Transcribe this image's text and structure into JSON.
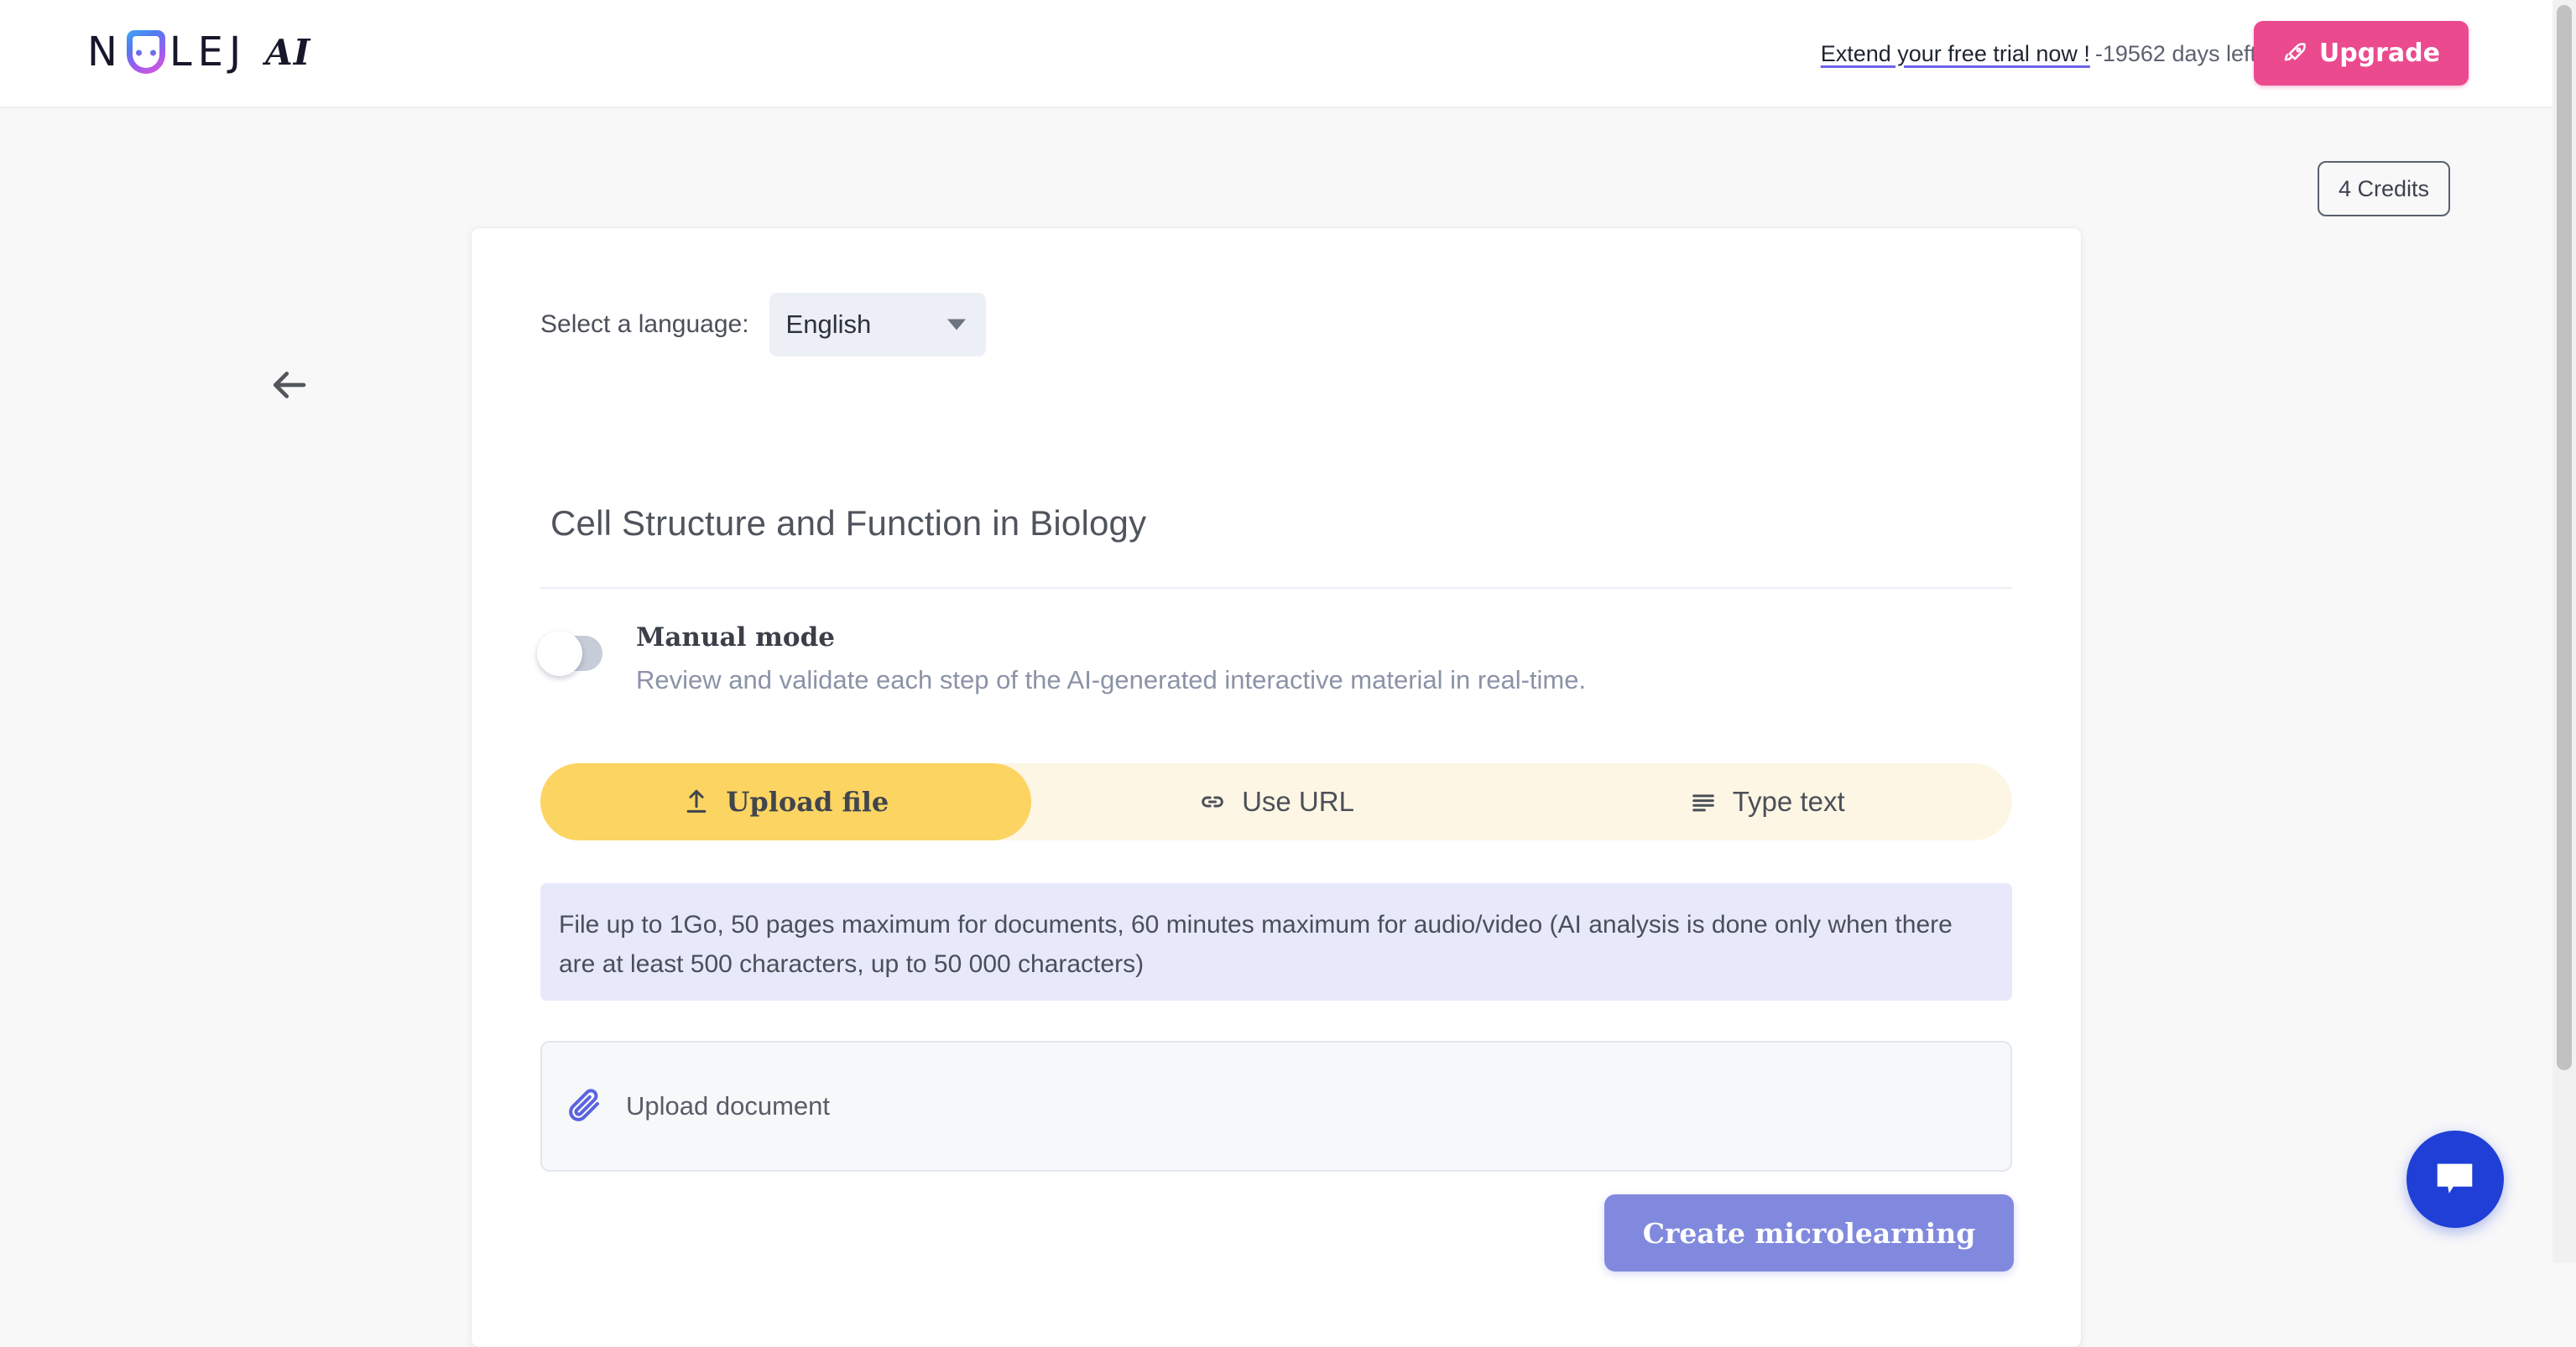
{
  "header": {
    "logo_text": "N LEJ",
    "logo_prefix": "N",
    "logo_suffix": "LEJ",
    "logo_ai": "AI",
    "logo_mark_icon": "nolej-face-logo",
    "trial_link": "Extend your free trial now !",
    "trial_days": "-19562 days left",
    "upgrade_label": "Upgrade",
    "upgrade_icon": "rocket-icon",
    "accent_pink": "#eb4a8e",
    "link_underline_color": "#6c63e8"
  },
  "page": {
    "credits_label": "4 Credits",
    "back_icon": "arrow-left-icon",
    "background": "#f8f8f9"
  },
  "form": {
    "language_label": "Select a language:",
    "language_value": "English",
    "language_caret_icon": "chevron-down-icon",
    "title": "Cell Structure and Function in Biology",
    "manual_mode": {
      "title": "Manual mode",
      "description": "Review and validate each step of the AI-generated interactive material in real-time.",
      "enabled": false
    },
    "tabs": [
      {
        "label": "Upload file",
        "icon": "upload-icon",
        "active": true
      },
      {
        "label": "Use URL",
        "icon": "link-icon",
        "active": false
      },
      {
        "label": "Type text",
        "icon": "text-lines-icon",
        "active": false
      }
    ],
    "tab_active_color": "#fcd462",
    "tab_bar_color": "#fdf6e4",
    "banner_text": "File up to 1Go, 50 pages maximum for documents, 60 minutes maximum for audio/video (AI analysis is done only when there are at least 500 characters, up to 50 000 characters)",
    "banner_color": "#e7e9fb",
    "dropzone_label": "Upload document",
    "dropzone_icon": "paperclip-icon",
    "submit_label": "Create microlearning",
    "submit_color": "#8189de"
  },
  "chat": {
    "icon": "chat-bubble-icon",
    "color": "#1f3fd6"
  }
}
